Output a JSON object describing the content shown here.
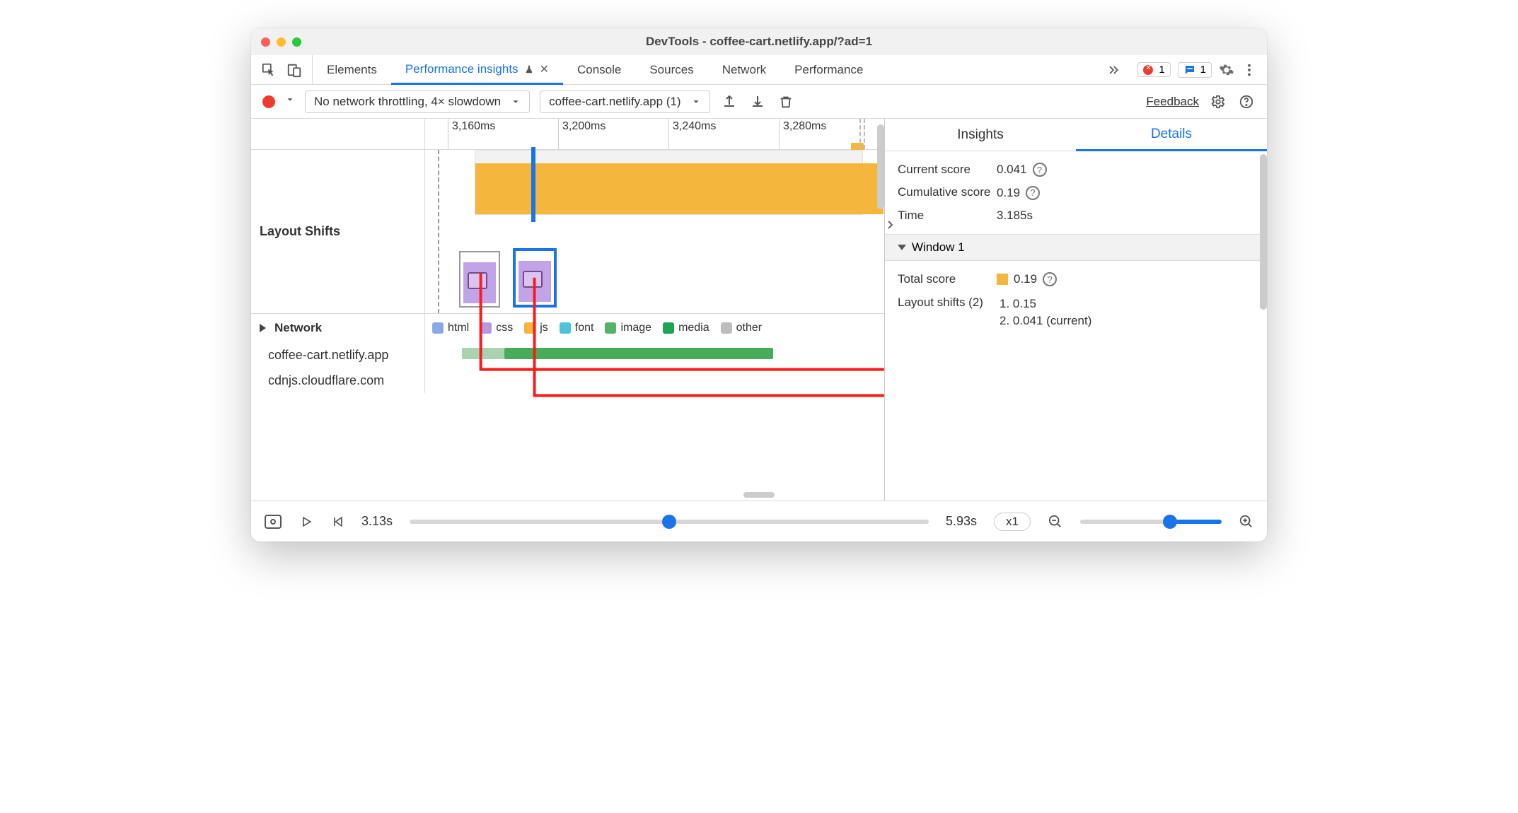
{
  "window": {
    "title": "DevTools - coffee-cart.netlify.app/?ad=1"
  },
  "tabs": {
    "items": [
      "Elements",
      "Performance insights",
      "Console",
      "Sources",
      "Network",
      "Performance"
    ],
    "active_index": 1
  },
  "badges": {
    "errors_count": "1",
    "messages_count": "1"
  },
  "toolbar": {
    "throttling_label": "No network throttling, 4× slowdown",
    "recording_label": "coffee-cart.netlify.app (1)",
    "feedback_label": "Feedback"
  },
  "timeline": {
    "ticks": [
      "3,160ms",
      "3,200ms",
      "3,240ms",
      "3,280ms"
    ],
    "row_layout_label": "Layout Shifts"
  },
  "network_legend": {
    "header": "Network",
    "kinds": [
      {
        "key": "html",
        "label": "html"
      },
      {
        "key": "css",
        "label": "css"
      },
      {
        "key": "js",
        "label": "js"
      },
      {
        "key": "font",
        "label": "font"
      },
      {
        "key": "image",
        "label": "image"
      },
      {
        "key": "media",
        "label": "media"
      },
      {
        "key": "other",
        "label": "other"
      }
    ],
    "hosts": [
      "coffee-cart.netlify.app",
      "cdnjs.cloudflare.com"
    ]
  },
  "right": {
    "tabs": [
      "Insights",
      "Details"
    ],
    "active_index": 1,
    "rows": {
      "current_score_label": "Current score",
      "current_score_value": "0.041",
      "cumulative_score_label": "Cumulative score",
      "cumulative_score_value": "0.19",
      "time_label": "Time",
      "time_value": "3.185s"
    },
    "window_header": "Window 1",
    "total_score_label": "Total score",
    "total_score_value": "0.19",
    "shifts_header": "Layout shifts (2)",
    "shifts": [
      "1. 0.15",
      "2. 0.041 (current)"
    ]
  },
  "playback": {
    "range_start": "3.13s",
    "range_end": "5.93s",
    "speed": "x1"
  }
}
